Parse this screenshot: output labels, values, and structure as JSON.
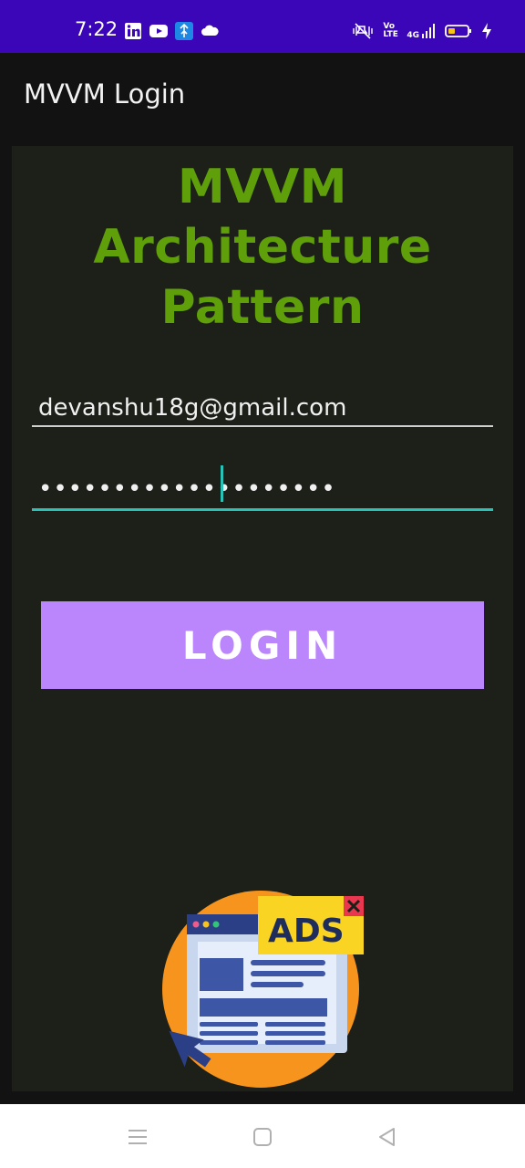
{
  "status_bar": {
    "time": "7:22",
    "volte_label": "Vo LTE",
    "network_label": "4G",
    "left_icons": [
      "linkedin-icon",
      "youtube-icon",
      "app-icon",
      "cloud-icon"
    ],
    "right_icons": [
      "mute-vibrate-icon",
      "volte-icon",
      "signal-icon",
      "battery-icon",
      "charging-icon"
    ],
    "background_color": "#3a06b8"
  },
  "app_bar": {
    "title": "MVVM Login"
  },
  "main": {
    "headline_line1": "MVVM Architecture",
    "headline_line2": "Pattern",
    "headline_color": "#5e9f0a",
    "email_value": "devanshu18g@gmail.com",
    "password_value": "••••••••••••••••••••",
    "focused_field_color": "#2ac1b6",
    "login_label": "LOGIN",
    "login_button_color": "#bb86fc",
    "ads_label": "ADS"
  },
  "nav_bar": {
    "buttons": [
      "menu-icon",
      "home-icon",
      "back-icon"
    ]
  }
}
